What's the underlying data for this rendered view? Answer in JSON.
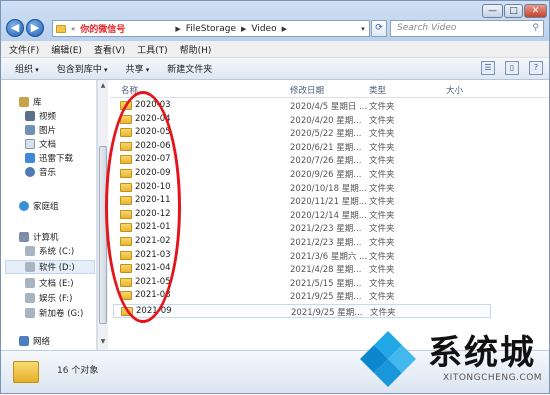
{
  "window": {
    "address_path": [
      "你的微信号",
      "FileStorage",
      "Video"
    ],
    "search_placeholder": "Search Video",
    "controls": {
      "minimize": "—",
      "maximize": "□",
      "close": "✕"
    }
  },
  "menu": [
    "文件(F)",
    "编辑(E)",
    "查看(V)",
    "工具(T)",
    "帮助(H)"
  ],
  "toolbar": {
    "organize": "组织",
    "include": "包含到库中",
    "share": "共享",
    "new_folder": "新建文件夹"
  },
  "nav": {
    "library": "库",
    "library_items": [
      "视频",
      "图片",
      "文档",
      "迅雷下载",
      "音乐"
    ],
    "homegroup": "家庭组",
    "computer": "计算机",
    "drives": [
      "系统 (C:)",
      "软件 (D:)",
      "文档 (E:)",
      "娱乐 (F:)",
      "新加卷 (G:)"
    ],
    "network": "网络"
  },
  "columns": {
    "name": "名称",
    "date": "修改日期",
    "type": "类型",
    "size": "大小"
  },
  "files": [
    {
      "name": "2020-03",
      "date": "2020/4/5 星期日 ...",
      "type": "文件夹"
    },
    {
      "name": "2020-04",
      "date": "2020/4/20 星期...",
      "type": "文件夹"
    },
    {
      "name": "2020-05",
      "date": "2020/5/22 星期...",
      "type": "文件夹"
    },
    {
      "name": "2020-06",
      "date": "2020/6/21 星期...",
      "type": "文件夹"
    },
    {
      "name": "2020-07",
      "date": "2020/7/26 星期...",
      "type": "文件夹"
    },
    {
      "name": "2020-09",
      "date": "2020/9/26 星期...",
      "type": "文件夹"
    },
    {
      "name": "2020-10",
      "date": "2020/10/18 星期...",
      "type": "文件夹"
    },
    {
      "name": "2020-11",
      "date": "2020/11/21 星期...",
      "type": "文件夹"
    },
    {
      "name": "2020-12",
      "date": "2020/12/14 星期...",
      "type": "文件夹"
    },
    {
      "name": "2021-01",
      "date": "2021/2/23 星期...",
      "type": "文件夹"
    },
    {
      "name": "2021-02",
      "date": "2021/2/23 星期...",
      "type": "文件夹"
    },
    {
      "name": "2021-03",
      "date": "2021/3/6 星期六 ...",
      "type": "文件夹"
    },
    {
      "name": "2021-04",
      "date": "2021/4/28 星期...",
      "type": "文件夹"
    },
    {
      "name": "2021-05",
      "date": "2021/5/15 星期...",
      "type": "文件夹"
    },
    {
      "name": "2021-08",
      "date": "2021/9/25 星期...",
      "type": "文件夹"
    },
    {
      "name": "2021-09",
      "date": "2021/9/25 星期...",
      "type": "文件夹"
    }
  ],
  "status": "16 个对象",
  "watermark": {
    "text": "系统城",
    "sub": "XITONGCHENG.COM"
  },
  "colors": {
    "annotation_red": "#e3151a",
    "accent_blue": "#1f5fb5"
  }
}
